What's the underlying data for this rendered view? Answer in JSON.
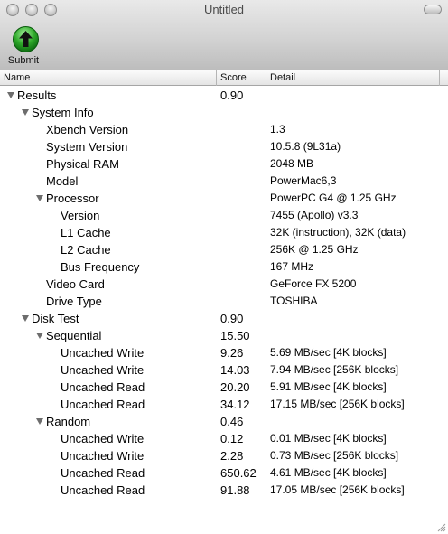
{
  "window": {
    "title": "Untitled"
  },
  "toolbar": {
    "submit_label": "Submit",
    "submit_icon": "submit-up-arrow-icon"
  },
  "columns": {
    "name": "Name",
    "score": "Score",
    "detail": "Detail"
  },
  "rows": [
    {
      "id": "results",
      "level": 0,
      "expandable": true,
      "name": "Results",
      "score": "0.90",
      "detail": ""
    },
    {
      "id": "system-info",
      "level": 1,
      "expandable": true,
      "name": "System Info",
      "score": "",
      "detail": ""
    },
    {
      "id": "xbench-version",
      "level": 2,
      "expandable": false,
      "name": "Xbench Version",
      "score": "",
      "detail": "1.3"
    },
    {
      "id": "system-version",
      "level": 2,
      "expandable": false,
      "name": "System Version",
      "score": "",
      "detail": "10.5.8 (9L31a)"
    },
    {
      "id": "physical-ram",
      "level": 2,
      "expandable": false,
      "name": "Physical RAM",
      "score": "",
      "detail": "2048 MB"
    },
    {
      "id": "model",
      "level": 2,
      "expandable": false,
      "name": "Model",
      "score": "",
      "detail": "PowerMac6,3"
    },
    {
      "id": "processor",
      "level": 2,
      "expandable": true,
      "name": "Processor",
      "score": "",
      "detail": "PowerPC G4 @ 1.25 GHz"
    },
    {
      "id": "version",
      "level": 3,
      "expandable": false,
      "name": "Version",
      "score": "",
      "detail": "7455 (Apollo) v3.3"
    },
    {
      "id": "l1-cache",
      "level": 3,
      "expandable": false,
      "name": "L1 Cache",
      "score": "",
      "detail": "32K (instruction), 32K (data)"
    },
    {
      "id": "l2-cache",
      "level": 3,
      "expandable": false,
      "name": "L2 Cache",
      "score": "",
      "detail": "256K @ 1.25 GHz"
    },
    {
      "id": "bus-frequency",
      "level": 3,
      "expandable": false,
      "name": "Bus Frequency",
      "score": "",
      "detail": "167 MHz"
    },
    {
      "id": "video-card",
      "level": 2,
      "expandable": false,
      "name": "Video Card",
      "score": "",
      "detail": "GeForce FX 5200"
    },
    {
      "id": "drive-type",
      "level": 2,
      "expandable": false,
      "name": "Drive Type",
      "score": "",
      "detail": "TOSHIBA"
    },
    {
      "id": "disk-test",
      "level": 1,
      "expandable": true,
      "name": "Disk Test",
      "score": "0.90",
      "detail": ""
    },
    {
      "id": "sequential",
      "level": 2,
      "expandable": true,
      "name": "Sequential",
      "score": "15.50",
      "detail": ""
    },
    {
      "id": "seq-uncached-write-4k",
      "level": 3,
      "expandable": false,
      "name": "Uncached Write",
      "score": "9.26",
      "detail": "5.69 MB/sec [4K blocks]"
    },
    {
      "id": "seq-uncached-write-256k",
      "level": 3,
      "expandable": false,
      "name": "Uncached Write",
      "score": "14.03",
      "detail": "7.94 MB/sec [256K blocks]"
    },
    {
      "id": "seq-uncached-read-4k",
      "level": 3,
      "expandable": false,
      "name": "Uncached Read",
      "score": "20.20",
      "detail": "5.91 MB/sec [4K blocks]"
    },
    {
      "id": "seq-uncached-read-256k",
      "level": 3,
      "expandable": false,
      "name": "Uncached Read",
      "score": "34.12",
      "detail": "17.15 MB/sec [256K blocks]"
    },
    {
      "id": "random",
      "level": 2,
      "expandable": true,
      "name": "Random",
      "score": "0.46",
      "detail": ""
    },
    {
      "id": "rnd-uncached-write-4k",
      "level": 3,
      "expandable": false,
      "name": "Uncached Write",
      "score": "0.12",
      "detail": "0.01 MB/sec [4K blocks]"
    },
    {
      "id": "rnd-uncached-write-256k",
      "level": 3,
      "expandable": false,
      "name": "Uncached Write",
      "score": "2.28",
      "detail": "0.73 MB/sec [256K blocks]"
    },
    {
      "id": "rnd-uncached-read-4k",
      "level": 3,
      "expandable": false,
      "name": "Uncached Read",
      "score": "650.62",
      "detail": "4.61 MB/sec [4K blocks]"
    },
    {
      "id": "rnd-uncached-read-256k",
      "level": 3,
      "expandable": false,
      "name": "Uncached Read",
      "score": "91.88",
      "detail": "17.05 MB/sec [256K blocks]"
    }
  ]
}
